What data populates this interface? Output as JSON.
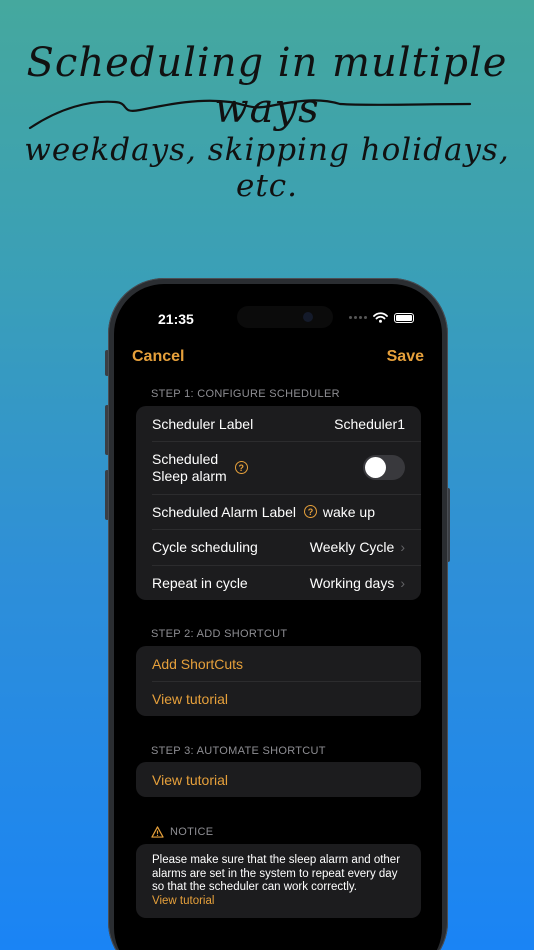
{
  "headline": {
    "title": "Scheduling in multiple ways",
    "subtitle": "weekdays, skipping holidays, etc."
  },
  "status_bar": {
    "time": "21:35"
  },
  "nav": {
    "cancel": "Cancel",
    "save": "Save"
  },
  "step1": {
    "header": "STEP 1: CONFIGURE SCHEDULER",
    "rows": [
      {
        "label": "Scheduler Label",
        "value": "Scheduler1"
      },
      {
        "label_line1": "Scheduled",
        "label_line2": "Sleep alarm",
        "toggle_on": false
      },
      {
        "label": "Scheduled Alarm Label",
        "value": "wake up"
      },
      {
        "label": "Cycle scheduling",
        "value": "Weekly Cycle"
      },
      {
        "label": "Repeat in cycle",
        "value": "Working days"
      }
    ]
  },
  "step2": {
    "header": "STEP 2: ADD SHORTCUT",
    "add_shortcuts": "Add ShortCuts",
    "view_tutorial": "View tutorial"
  },
  "step3": {
    "header": "STEP 3: AUTOMATE SHORTCUT",
    "view_tutorial": "View tutorial"
  },
  "notice": {
    "header": "NOTICE",
    "text": "Please make sure that the sleep alarm and other alarms are set in the system to repeat every day so that the scheduler can work correctly.",
    "link": "View tutorial"
  },
  "colors": {
    "accent": "#e6a03b",
    "cell_bg": "#1c1c1e",
    "screen_bg": "#000000"
  }
}
